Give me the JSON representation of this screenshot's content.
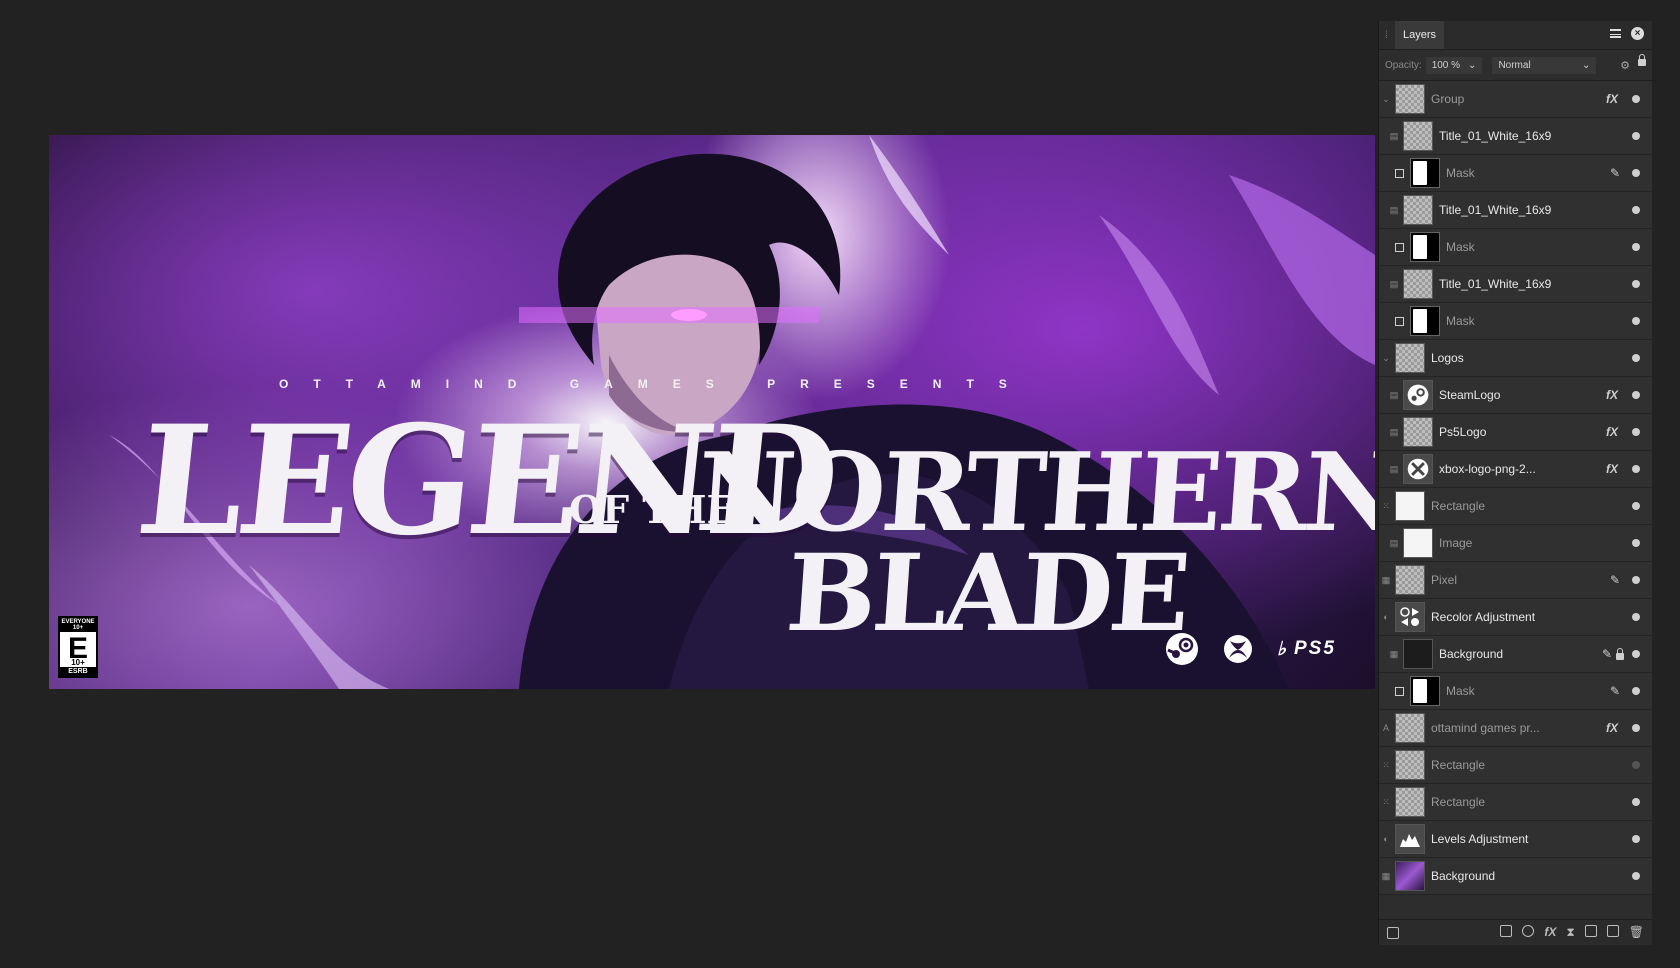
{
  "canvas": {
    "presents_text": "OTTAMIND GAMES PRESENTS",
    "title_legend": "LEGEND",
    "title_of_the": "OF THE",
    "title_northern": "NORTHERN",
    "title_blade": "BLADE",
    "esrb": {
      "top": "EVERYONE 10+",
      "letter": "E",
      "age": "10+",
      "bottom": "ESRB"
    },
    "platforms": {
      "ps5": "PS5"
    }
  },
  "panel": {
    "tab_label": "Layers",
    "opacity_label": "Opacity:",
    "opacity_value": "100 %",
    "blend_mode": "Normal"
  },
  "layers": [
    {
      "name": "Group",
      "fx": "fX",
      "dim": true
    },
    {
      "name": "Title_01_White_16x9"
    },
    {
      "name": "Mask",
      "dim": true
    },
    {
      "name": "Title_01_White_16x9"
    },
    {
      "name": "Mask",
      "dim": true
    },
    {
      "name": "Title_01_White_16x9"
    },
    {
      "name": "Mask",
      "dim": true
    },
    {
      "name": "Logos"
    },
    {
      "name": "SteamLogo",
      "fx": "fX"
    },
    {
      "name": "Ps5Logo",
      "fx": "fX"
    },
    {
      "name": "xbox-logo-png-2...",
      "fx": "fX"
    },
    {
      "name": "Rectangle",
      "dim": true
    },
    {
      "name": "Image",
      "dim": true
    },
    {
      "name": "Pixel",
      "dim": true
    },
    {
      "name": "Recolor Adjustment"
    },
    {
      "name": "Background"
    },
    {
      "name": "Mask",
      "dim": true
    },
    {
      "name": "ottamind games pr...",
      "fx": "fX",
      "dim": true
    },
    {
      "name": "Rectangle",
      "dim": true
    },
    {
      "name": "Rectangle",
      "dim": true
    },
    {
      "name": "Levels Adjustment"
    },
    {
      "name": "Background"
    }
  ],
  "colors": {
    "canvas_bg": "#222222",
    "panel_bg": "#2d2d2d",
    "accent_purple": "#9b59d0"
  }
}
